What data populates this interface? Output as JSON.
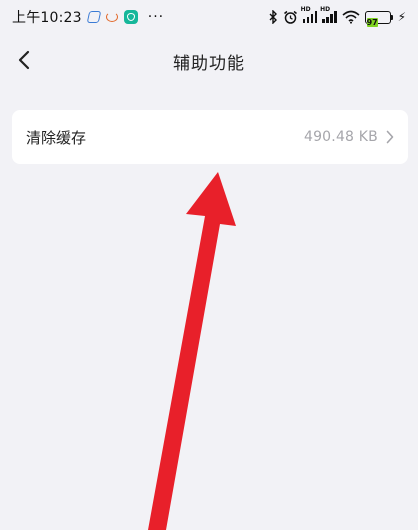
{
  "status_bar": {
    "time": "上午10:23",
    "more": "···",
    "battery_level": "97",
    "network_badge": "HD"
  },
  "header": {
    "title": "辅助功能"
  },
  "settings": {
    "clear_cache_label": "清除缓存",
    "clear_cache_value": "490.48 KB"
  },
  "colors": {
    "background": "#f2f2f6",
    "card": "#ffffff",
    "secondary_text": "#a6a6ab",
    "annotation_arrow": "#e8202a",
    "battery_fill": "#7fd321"
  }
}
